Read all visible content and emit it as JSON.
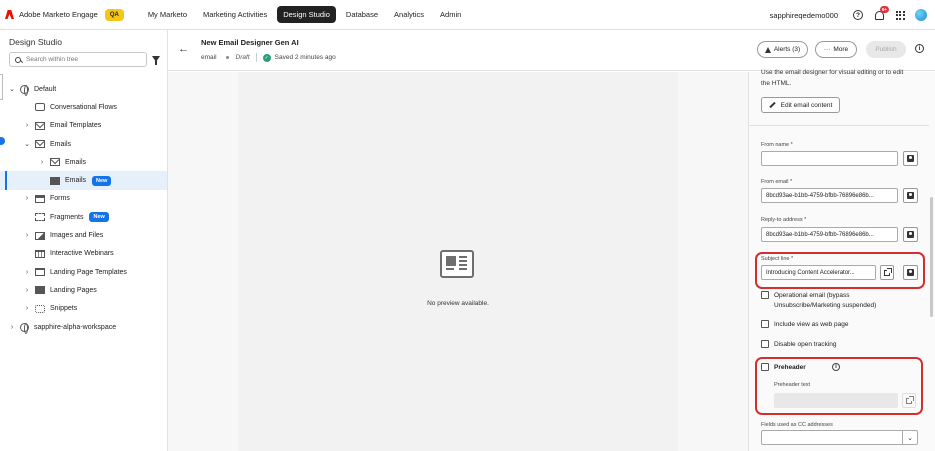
{
  "app": {
    "name": "Adobe Marketo Engage",
    "env_badge": "QA",
    "nav": [
      "My Marketo",
      "Marketing Activities",
      "Design Studio",
      "Database",
      "Analytics",
      "Admin"
    ],
    "active_nav": "Design Studio",
    "user": "sapphireqedemo000",
    "help_icon": "help-icon",
    "notifications_count": "9+",
    "brand_color": "#eb1000",
    "qa_color": "#f5c518"
  },
  "sidebar": {
    "title": "Design Studio",
    "search_placeholder": "Search within tree",
    "tree": [
      {
        "label": "Default",
        "icon": "globe-icon",
        "chevron": "⌄",
        "indent": 0
      },
      {
        "label": "Conversational Flows",
        "icon": "chat-icon",
        "chevron": "",
        "indent": 1
      },
      {
        "label": "Email Templates",
        "icon": "mail-icon",
        "chevron": "›",
        "indent": 1
      },
      {
        "label": "Emails",
        "icon": "mail-icon",
        "chevron": "⌄",
        "indent": 1
      },
      {
        "label": "Emails",
        "icon": "mail-icon",
        "chevron": "›",
        "indent": 2
      },
      {
        "label": "Emails",
        "icon": "mail-icon",
        "chevron": "",
        "indent": 2,
        "badge": "New",
        "selected": true
      },
      {
        "label": "Forms",
        "icon": "form-icon",
        "chevron": "›",
        "indent": 1
      },
      {
        "label": "Fragments",
        "icon": "fragment-icon",
        "chevron": "",
        "indent": 1,
        "badge": "New"
      },
      {
        "label": "Images and Files",
        "icon": "image-icon",
        "chevron": "›",
        "indent": 1
      },
      {
        "label": "Interactive Webinars",
        "icon": "calendar-icon",
        "chevron": "",
        "indent": 1
      },
      {
        "label": "Landing Page Templates",
        "icon": "page-icon",
        "chevron": "›",
        "indent": 1
      },
      {
        "label": "Landing Pages",
        "icon": "landing-page-icon",
        "chevron": "›",
        "indent": 1
      },
      {
        "label": "Snippets",
        "icon": "snippet-icon",
        "chevron": "›",
        "indent": 1
      },
      {
        "label": "sapphire-alpha-workspace",
        "icon": "globe-icon",
        "chevron": "›",
        "indent": 0
      }
    ]
  },
  "header": {
    "title": "New Email Designer Gen AI",
    "type": "email",
    "status": "Draft",
    "saved": "Saved 2 minutes ago",
    "alerts_label": "Alerts (3)",
    "more_label": "More",
    "publish_label": "Publish"
  },
  "preview": {
    "empty_text": "No preview available."
  },
  "panel": {
    "intro_text": "Use the email designer for visual editing or to edit",
    "intro_text_2": "the HTML.",
    "edit_button": "Edit email content",
    "from_name": {
      "label": "From name *",
      "value": ""
    },
    "from_email": {
      "label": "From email *",
      "value": "8bcd93ae-b1bb-4759-bfbb-76896e86b..."
    },
    "reply_to": {
      "label": "Reply-to address *",
      "value": "8bcd93ae-b1bb-4759-bfbb-76896e86b..."
    },
    "subject": {
      "label": "Subject line *",
      "value": "Introducing Content Accelerator..."
    },
    "operational_line1": "Operational email (bypass",
    "operational_line2": "Unsubscribe/Marketing suspended)",
    "web_page": "Include view as web page",
    "disable_tracking": "Disable open tracking",
    "preheader_label": "Preheader",
    "preheader_text_label": "Preheader text",
    "cc_label": "Fields used as CC addresses",
    "highlight_color": "#d32f2f"
  }
}
